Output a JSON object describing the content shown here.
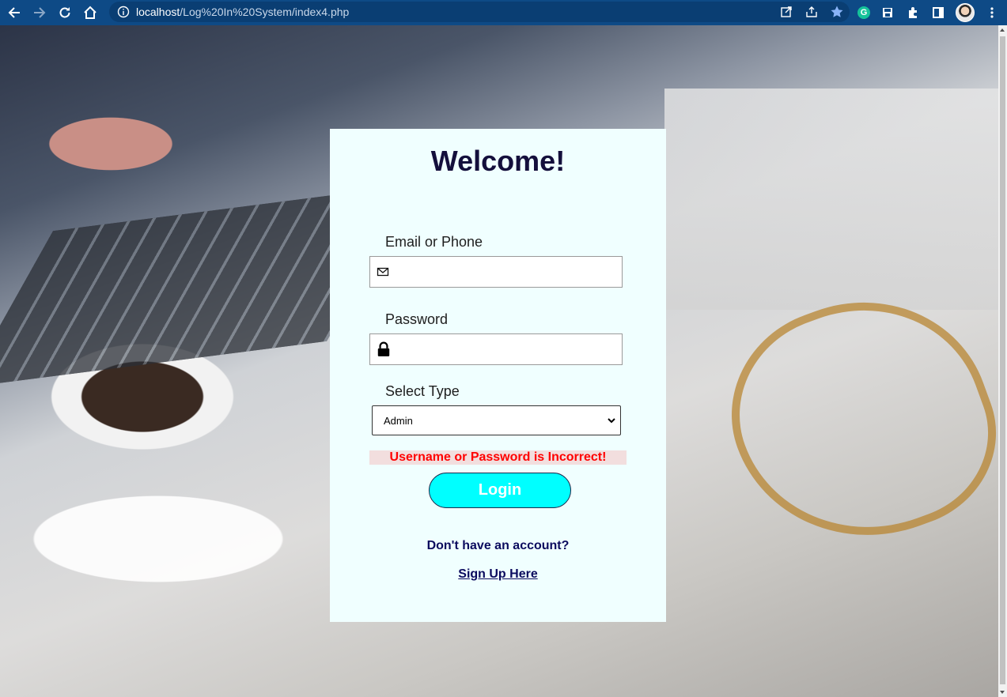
{
  "browser": {
    "url_host": "localhost",
    "url_path": "/Log%20In%20System/index4.php",
    "toolbar_bg": "#0e4a86",
    "extension_initial": "G"
  },
  "login": {
    "title": "Welcome!",
    "email_label": "Email or Phone",
    "email_value": "",
    "password_label": "Password",
    "password_value": "",
    "type_label": "Select Type",
    "type_selected": "Admin",
    "error_message": "Username or Password is Incorrect!",
    "login_button": "Login",
    "no_account_text": "Don't have an account?",
    "signup_link": "Sign Up Here"
  },
  "colors": {
    "card_bg": "#f0ffff",
    "button_bg": "#00ffff",
    "error_text": "#ff0000",
    "error_bg": "#f2dede",
    "heading": "#140f3c"
  },
  "icons": {
    "email": "envelope-icon",
    "password": "lock-icon"
  }
}
